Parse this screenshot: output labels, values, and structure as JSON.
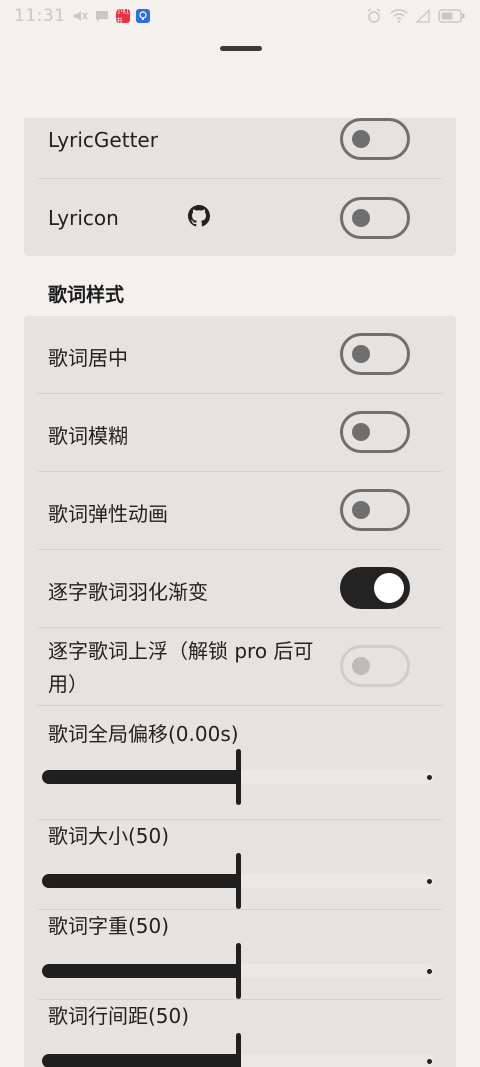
{
  "status_bar": {
    "time": "11:31",
    "badge_red": "小红书",
    "colors": {
      "red_badge": "#e8333f",
      "blue_badge": "#2f6de1"
    }
  },
  "top_card": {
    "items": [
      {
        "label": "LyricGetter",
        "toggle": false
      },
      {
        "label": "Lyricon",
        "toggle": false,
        "icon": "github-icon"
      }
    ]
  },
  "section": {
    "title": "歌词样式"
  },
  "toggles": [
    {
      "label": "歌词居中",
      "on": false,
      "disabled": false
    },
    {
      "label": "歌词模糊",
      "on": false,
      "disabled": false
    },
    {
      "label": "歌词弹性动画",
      "on": false,
      "disabled": false
    },
    {
      "label": "逐字歌词羽化渐变",
      "on": true,
      "disabled": false
    },
    {
      "label": "逐字歌词上浮（解锁 pro 后可用）",
      "on": false,
      "disabled": true
    }
  ],
  "sliders": [
    {
      "label": "歌词全局偏移(0.00s)",
      "value_fraction": 0.5
    },
    {
      "label": "歌词大小(50)",
      "value_fraction": 0.5
    },
    {
      "label": "歌词字重(50)",
      "value_fraction": 0.5
    },
    {
      "label": "歌词行间距(50)",
      "value_fraction": 0.5
    }
  ],
  "theme": {
    "accent": "#232323",
    "card_bg": "#e6e2e0",
    "page_bg": "#f3f0ee"
  }
}
